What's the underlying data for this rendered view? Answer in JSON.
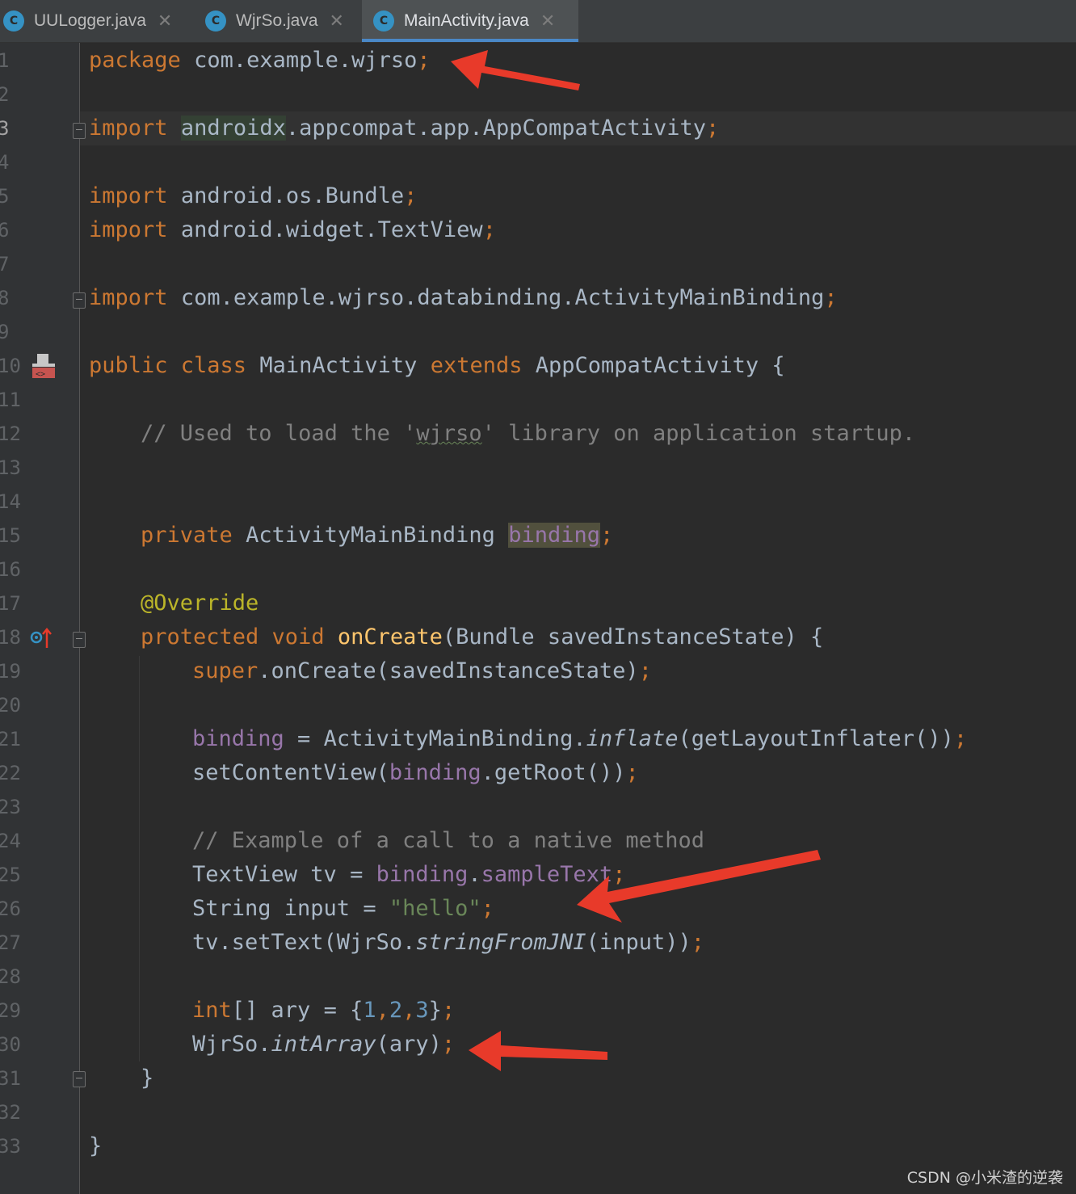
{
  "tabs": [
    {
      "label": "UULogger.java",
      "icon": "class-icon",
      "active": false
    },
    {
      "label": "WjrSo.java",
      "icon": "class-icon",
      "active": false
    },
    {
      "label": "MainActivity.java",
      "icon": "class-icon",
      "active": true
    }
  ],
  "tab_icon_letter": "C",
  "tab_close_glyph": "✕",
  "current_line": 3,
  "line_numbers": [
    "1",
    "2",
    "3",
    "4",
    "5",
    "6",
    "7",
    "8",
    "9",
    "10",
    "11",
    "12",
    "13",
    "14",
    "15",
    "16",
    "17",
    "18",
    "19",
    "20",
    "21",
    "22",
    "23",
    "24",
    "25",
    "26",
    "27",
    "28",
    "29",
    "30",
    "31",
    "32",
    "33"
  ],
  "code": {
    "l1": {
      "kw": "package",
      "pkg": "com.example.wjrso",
      "semi": ";"
    },
    "l3": {
      "kw": "import",
      "hl": "androidx",
      "rest": ".appcompat.app.AppCompatActivity",
      "semi": ";"
    },
    "l5": {
      "kw": "import",
      "rest": "android.os.Bundle",
      "semi": ";"
    },
    "l6": {
      "kw": "import",
      "rest": "android.widget.TextView",
      "semi": ";"
    },
    "l8": {
      "kw": "import",
      "rest": "com.example.wjrso.databinding.ActivityMainBinding",
      "semi": ";"
    },
    "l10": {
      "kw1": "public class",
      "name": "MainActivity",
      "kw2": "extends",
      "parent": "AppCompatActivity",
      "brace": "{"
    },
    "l12": {
      "pre": "// Used to load the '",
      "word": "wjrso",
      "post": "' library on application startup."
    },
    "l15": {
      "kw": "private",
      "type": "ActivityMainBinding",
      "field": "binding",
      "semi": ";"
    },
    "l17": {
      "annotation": "@Override"
    },
    "l18": {
      "kw": "protected void",
      "method": "onCreate",
      "params": "(Bundle savedInstanceState) {"
    },
    "l19": {
      "kw": "super",
      "rest": ".onCreate(savedInstanceState)",
      "semi": ";"
    },
    "l21": {
      "field": "binding",
      "mid": " = ActivityMainBinding.",
      "italic": "inflate",
      "rest": "(getLayoutInflater())",
      "semi": ";"
    },
    "l22": {
      "pre": "setContentView(",
      "field": "binding",
      "rest": ".getRoot())",
      "semi": ";"
    },
    "l24": {
      "comment": "// Example of a call to a native method"
    },
    "l25": {
      "pre": "TextView tv = ",
      "field": "binding",
      "dot": ".",
      "field2": "sampleText",
      "semi": ";"
    },
    "l26": {
      "pre": "String input = ",
      "str": "\"hello\"",
      "semi": ";"
    },
    "l27": {
      "pre": "tv.setText(WjrSo.",
      "italic": "stringFromJNI",
      "rest": "(input))",
      "semi": ";"
    },
    "l29": {
      "kw": "int",
      "mid": "[] ary = {",
      "n1": "1",
      "c1": ",",
      "n2": "2",
      "c2": ",",
      "n3": "3",
      "end": "}",
      "semi": ";"
    },
    "l30": {
      "pre": "WjrSo.",
      "italic": "intArray",
      "rest": "(ary)",
      "semi": ";"
    },
    "l31": {
      "brace": "}"
    },
    "l33": {
      "brace": "}"
    }
  },
  "gutter_icons": {
    "line10": "implemented-layout-icon",
    "line18": "override-method-icon"
  },
  "colors": {
    "background": "#2b2b2b",
    "keyword": "#cc7832",
    "plain": "#a9b7c6",
    "field": "#9876aa",
    "string": "#6a8759",
    "number": "#6897bb",
    "comment": "#808080",
    "annotation": "#bbb529",
    "method_decl": "#ffc66d",
    "arrow": "#e83a2a"
  },
  "watermark": "CSDN @小米渣的逆袭"
}
